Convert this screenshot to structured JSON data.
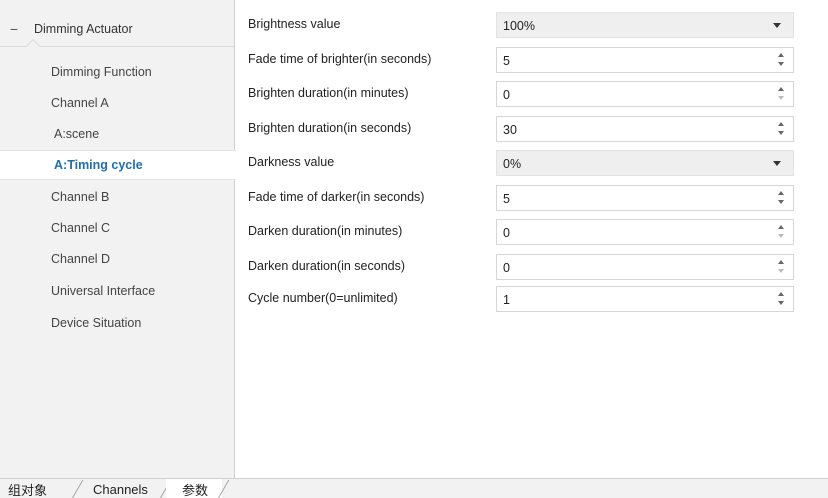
{
  "sidebar": {
    "root": {
      "label": "Dimming Actuator",
      "expanded_symbol": "−"
    },
    "items": [
      {
        "label": "Dimming Function",
        "selected": false
      },
      {
        "label": "Channel A",
        "selected": false
      },
      {
        "label": "A:scene",
        "selected": false
      },
      {
        "label": "A:Timing cycle",
        "selected": true
      },
      {
        "label": "Channel B",
        "selected": false
      },
      {
        "label": "Channel C",
        "selected": false
      },
      {
        "label": "Channel D",
        "selected": false
      },
      {
        "label": "Universal Interface",
        "selected": false
      },
      {
        "label": "Device Situation",
        "selected": false
      }
    ]
  },
  "params": [
    {
      "label": "Brightness value",
      "value": "100%",
      "control": "dropdown"
    },
    {
      "label": "Fade time of brighter(in seconds)",
      "value": "5",
      "control": "spinner"
    },
    {
      "label": "Brighten duration(in minutes)",
      "value": "0",
      "control": "spinner"
    },
    {
      "label": "Brighten duration(in seconds)",
      "value": "30",
      "control": "spinner"
    },
    {
      "label": "Darkness value",
      "value": "0%",
      "control": "dropdown"
    },
    {
      "label": "Fade time of darker(in seconds)",
      "value": "5",
      "control": "spinner"
    },
    {
      "label": "Darken duration(in minutes)",
      "value": "0",
      "control": "spinner"
    },
    {
      "label": "Darken duration(in seconds)",
      "value": "0",
      "control": "spinner"
    },
    {
      "label": "Cycle number(0=unlimited)",
      "value": "1",
      "control": "spinner"
    }
  ],
  "tabs": [
    {
      "label": "组对象",
      "active": false
    },
    {
      "label": "Channels",
      "active": false
    },
    {
      "label": "参数",
      "active": true
    }
  ],
  "colors": {
    "selected_text": "#1f6fae",
    "sidebar_bg": "#f2f2f2",
    "dropdown_bg": "#efefef"
  }
}
